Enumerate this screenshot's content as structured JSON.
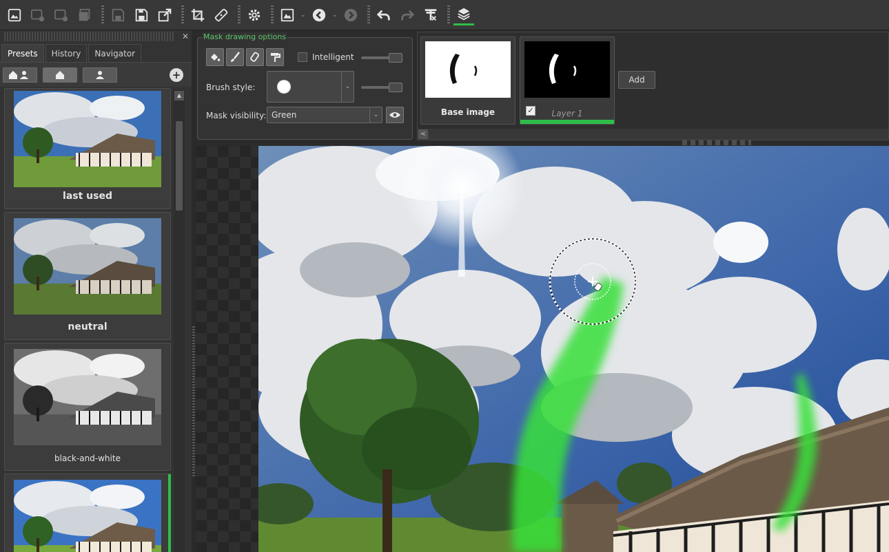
{
  "toolbar": {
    "buttons": [
      {
        "name": "open-image-icon",
        "state": "enabled"
      },
      {
        "name": "add-image-icon",
        "state": "disabled"
      },
      {
        "name": "remove-image-icon",
        "state": "disabled"
      },
      {
        "name": "batch-icon",
        "state": "disabled"
      },
      {
        "name": "save-icon",
        "state": "disabled"
      },
      {
        "name": "save-as-icon",
        "state": "enabled"
      },
      {
        "name": "export-icon",
        "state": "enabled"
      },
      {
        "name": "crop-icon",
        "state": "enabled"
      },
      {
        "name": "straighten-icon",
        "state": "enabled"
      },
      {
        "name": "settings-icon",
        "state": "enabled"
      },
      {
        "name": "view-mode-icon",
        "state": "enabled"
      },
      {
        "name": "back-icon",
        "state": "enabled"
      },
      {
        "name": "forward-icon",
        "state": "disabled"
      },
      {
        "name": "undo-icon",
        "state": "enabled"
      },
      {
        "name": "redo-icon",
        "state": "disabled"
      },
      {
        "name": "clear-history-icon",
        "state": "enabled"
      },
      {
        "name": "layers-icon",
        "state": "active"
      }
    ]
  },
  "left_panel": {
    "tabs": [
      "Presets",
      "History",
      "Navigator"
    ],
    "active_tab": "Presets",
    "filter_buttons": [
      "all-presets-icon",
      "builtin-presets-icon",
      "user-presets-icon"
    ],
    "add_preset_icon": "plus-circle-icon",
    "presets": [
      {
        "name": "last used",
        "style": "bold"
      },
      {
        "name": "neutral",
        "style": "bold"
      },
      {
        "name": "black-and-white",
        "style": "normal"
      },
      {
        "name": "",
        "style": "normal",
        "selected": true
      }
    ]
  },
  "mask_options": {
    "title": "Mask drawing options",
    "tool_icons": [
      "fill-bucket-icon",
      "brush-icon",
      "eraser-icon",
      "paint-roller-icon"
    ],
    "intelligent_label": "Intelligent",
    "intelligent_checked": false,
    "brush_style_label": "Brush style:",
    "mask_visibility_label": "Mask visibility:",
    "mask_visibility_value": "Green"
  },
  "layers": {
    "items": [
      {
        "name": "Base image",
        "checked": null,
        "active": false
      },
      {
        "name": "Layer 1",
        "checked": true,
        "active": true
      }
    ],
    "add_label": "Add",
    "scroll_left": "<"
  },
  "colors": {
    "accent_green": "#2fbd4a",
    "mask_green": "#39e03a",
    "panel_bg": "#333333",
    "toolbar_bg": "#383838"
  }
}
